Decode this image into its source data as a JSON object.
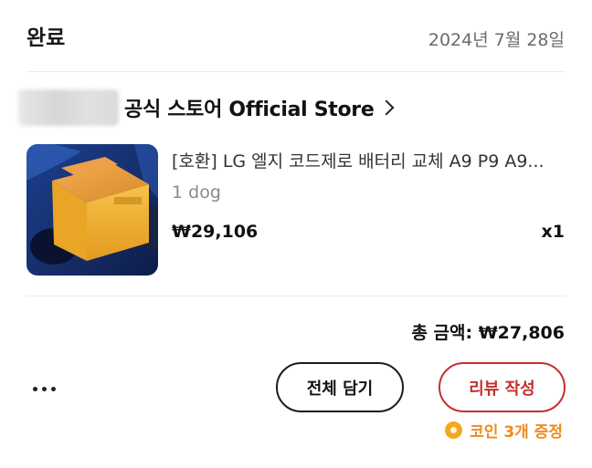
{
  "order": {
    "status": "완료",
    "date": "2024년 7월 28일"
  },
  "store": {
    "name": "공식 스토어 Official Store"
  },
  "product": {
    "title": "[호환] LG 엘지 코드제로 배터리 교체 A9 P9 A9...",
    "option": "1 dog",
    "price": "₩29,106",
    "quantity": "x1"
  },
  "summary": {
    "total": "총 금액: ₩27,806"
  },
  "actions": {
    "add_all_label": "전체 담기",
    "review_label": "리뷰 작성",
    "coin_reward": "코인 3개 증정"
  },
  "icons": {
    "more": "more-dots-icon",
    "coin": "coin-icon",
    "chevron": "chevron-right-icon"
  },
  "colors": {
    "accent_red": "#c4302b",
    "coin_orange": "#ef8a1c"
  }
}
